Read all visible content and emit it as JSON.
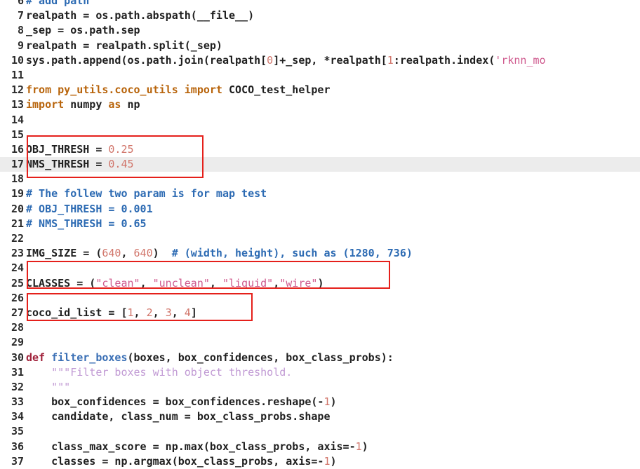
{
  "editor": {
    "lines": [
      {
        "num": "6",
        "tokens": [
          {
            "t": "# add path",
            "c": "com"
          }
        ]
      },
      {
        "num": "7",
        "tokens": [
          {
            "t": "realpath = os.path.abspath(__file__)",
            "c": "id"
          }
        ]
      },
      {
        "num": "8",
        "tokens": [
          {
            "t": "_sep = os.path.sep",
            "c": "id"
          }
        ]
      },
      {
        "num": "9",
        "tokens": [
          {
            "t": "realpath = realpath.split(_sep)",
            "c": "id"
          }
        ]
      },
      {
        "num": "10",
        "tokens": [
          {
            "t": "sys.path.append(os.path.join(realpath[",
            "c": "id"
          },
          {
            "t": "0",
            "c": "num"
          },
          {
            "t": "]+_sep, *realpath[",
            "c": "id"
          },
          {
            "t": "1",
            "c": "num"
          },
          {
            "t": ":realpath.index(",
            "c": "id"
          },
          {
            "t": "'rknn_mo",
            "c": "str"
          }
        ]
      },
      {
        "num": "11",
        "tokens": []
      },
      {
        "num": "12",
        "tokens": [
          {
            "t": "from ",
            "c": "kw"
          },
          {
            "t": "py_utils.coco_utils ",
            "c": "mod"
          },
          {
            "t": "import ",
            "c": "kw"
          },
          {
            "t": "COCO_test_helper",
            "c": "id"
          }
        ]
      },
      {
        "num": "13",
        "tokens": [
          {
            "t": "import ",
            "c": "kw"
          },
          {
            "t": "numpy ",
            "c": "id"
          },
          {
            "t": "as ",
            "c": "kw"
          },
          {
            "t": "np",
            "c": "id"
          }
        ]
      },
      {
        "num": "14",
        "tokens": []
      },
      {
        "num": "15",
        "tokens": []
      },
      {
        "num": "16",
        "tokens": [
          {
            "t": "OBJ_THRESH = ",
            "c": "id"
          },
          {
            "t": "0.25",
            "c": "num"
          }
        ]
      },
      {
        "num": "17",
        "tokens": [
          {
            "t": "NMS_THRESH = ",
            "c": "id"
          },
          {
            "t": "0.45",
            "c": "num"
          }
        ],
        "current": true
      },
      {
        "num": "18",
        "tokens": []
      },
      {
        "num": "19",
        "tokens": [
          {
            "t": "# The follew two param is for map test",
            "c": "com"
          }
        ]
      },
      {
        "num": "20",
        "tokens": [
          {
            "t": "# OBJ_THRESH = 0.001",
            "c": "com"
          }
        ]
      },
      {
        "num": "21",
        "tokens": [
          {
            "t": "# NMS_THRESH = 0.65",
            "c": "com"
          }
        ]
      },
      {
        "num": "22",
        "tokens": []
      },
      {
        "num": "23",
        "tokens": [
          {
            "t": "IMG_SIZE = (",
            "c": "id"
          },
          {
            "t": "640",
            "c": "num"
          },
          {
            "t": ", ",
            "c": "id"
          },
          {
            "t": "640",
            "c": "num"
          },
          {
            "t": ")  ",
            "c": "id"
          },
          {
            "t": "# (width, height), such as (1280, 736)",
            "c": "com"
          }
        ]
      },
      {
        "num": "24",
        "tokens": []
      },
      {
        "num": "25",
        "tokens": [
          {
            "t": "CLASSES = (",
            "c": "id"
          },
          {
            "t": "\"clean\"",
            "c": "str"
          },
          {
            "t": ", ",
            "c": "id"
          },
          {
            "t": "\"unclean\"",
            "c": "str"
          },
          {
            "t": ", ",
            "c": "id"
          },
          {
            "t": "\"liquid\"",
            "c": "str"
          },
          {
            "t": ",",
            "c": "id"
          },
          {
            "t": "\"wire\"",
            "c": "str"
          },
          {
            "t": ")",
            "c": "id"
          }
        ]
      },
      {
        "num": "26",
        "tokens": []
      },
      {
        "num": "27",
        "tokens": [
          {
            "t": "coco_id_list = [",
            "c": "id"
          },
          {
            "t": "1",
            "c": "num"
          },
          {
            "t": ", ",
            "c": "id"
          },
          {
            "t": "2",
            "c": "num"
          },
          {
            "t": ", ",
            "c": "id"
          },
          {
            "t": "3",
            "c": "num"
          },
          {
            "t": ", ",
            "c": "id"
          },
          {
            "t": "4",
            "c": "num"
          },
          {
            "t": "]",
            "c": "id"
          }
        ]
      },
      {
        "num": "28",
        "tokens": []
      },
      {
        "num": "29",
        "tokens": []
      },
      {
        "num": "30",
        "tokens": [
          {
            "t": "def ",
            "c": "kw-strong"
          },
          {
            "t": "filter_boxes",
            "c": "fn"
          },
          {
            "t": "(boxes, box_confidences, box_class_probs):",
            "c": "id"
          }
        ]
      },
      {
        "num": "31",
        "tokens": [
          {
            "t": "    ",
            "c": "id"
          },
          {
            "t": "\"\"\"Filter boxes with object threshold.",
            "c": "doc"
          }
        ]
      },
      {
        "num": "32",
        "tokens": [
          {
            "t": "    ",
            "c": "id"
          },
          {
            "t": "\"\"\"",
            "c": "doc"
          }
        ]
      },
      {
        "num": "33",
        "tokens": [
          {
            "t": "    box_confidences = box_confidences.reshape(-",
            "c": "id"
          },
          {
            "t": "1",
            "c": "num"
          },
          {
            "t": ")",
            "c": "id"
          }
        ]
      },
      {
        "num": "34",
        "tokens": [
          {
            "t": "    candidate, class_num = box_class_probs.shape",
            "c": "id"
          }
        ]
      },
      {
        "num": "35",
        "tokens": []
      },
      {
        "num": "36",
        "tokens": [
          {
            "t": "    class_max_score = np.max(box_class_probs, axis=-",
            "c": "id"
          },
          {
            "t": "1",
            "c": "num"
          },
          {
            "t": ")",
            "c": "id"
          }
        ]
      },
      {
        "num": "37",
        "tokens": [
          {
            "t": "    classes = np.argmax(box_class_probs, axis=-",
            "c": "id"
          },
          {
            "t": "1",
            "c": "num"
          },
          {
            "t": ")",
            "c": "id"
          }
        ]
      }
    ]
  },
  "highlights": [
    {
      "name": "thresh-highlight-box",
      "label": "thresholds"
    },
    {
      "name": "classes-highlight-box",
      "label": "classes"
    },
    {
      "name": "coco-id-highlight-box",
      "label": "coco_id_list"
    }
  ],
  "colors": {
    "highlight_border": "#e5201b",
    "current_line": "#ececec",
    "number": "#d1756a",
    "string": "#cf5a8e",
    "comment": "#2d6bb3",
    "keyword": "#b8640b"
  }
}
